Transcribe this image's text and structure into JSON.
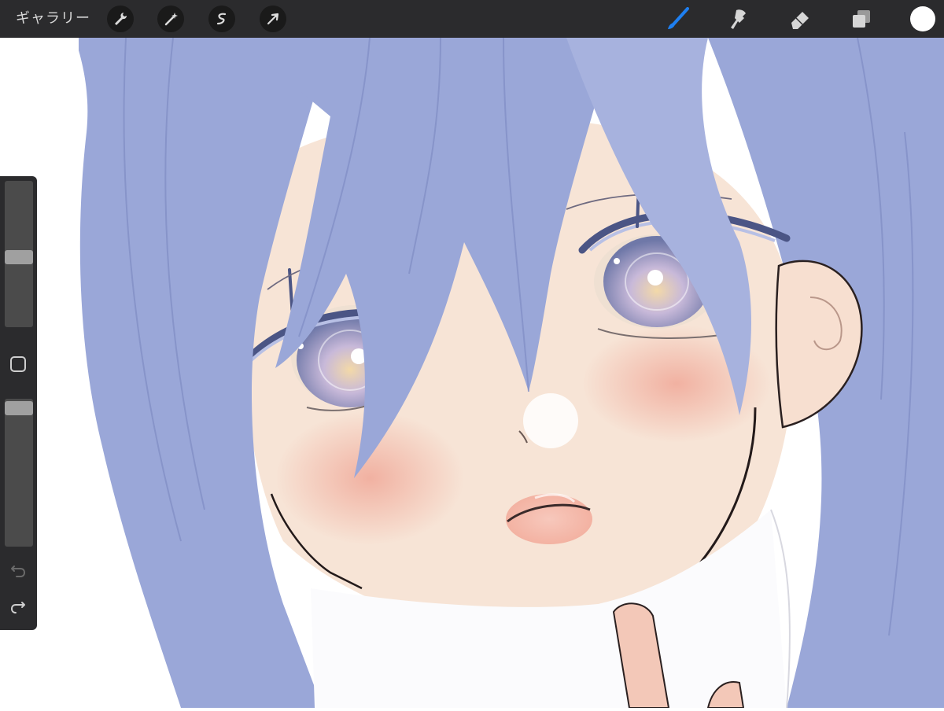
{
  "toolbar": {
    "gallery_label": "ギャラリー",
    "left_icons": [
      "wrench-icon",
      "magic-wand-icon",
      "selection-icon",
      "transform-arrow-icon"
    ],
    "right_icons": [
      "brush-icon",
      "smudge-icon",
      "eraser-icon",
      "layers-icon",
      "color-icon"
    ],
    "active_tool": "brush",
    "accent_color": "#1e7ff0",
    "current_color": "#ffffff"
  },
  "sidebar": {
    "brush_size_level": 0.42,
    "opacity_level": 0.98,
    "icons": [
      "modify-button-icon",
      "undo-icon",
      "redo-icon"
    ]
  },
  "canvas": {
    "colors": {
      "hair": "#9aa7d8",
      "skin": "#f7e4d6",
      "blush": "#f1b2a2",
      "collar": "#fbfbfd"
    }
  }
}
